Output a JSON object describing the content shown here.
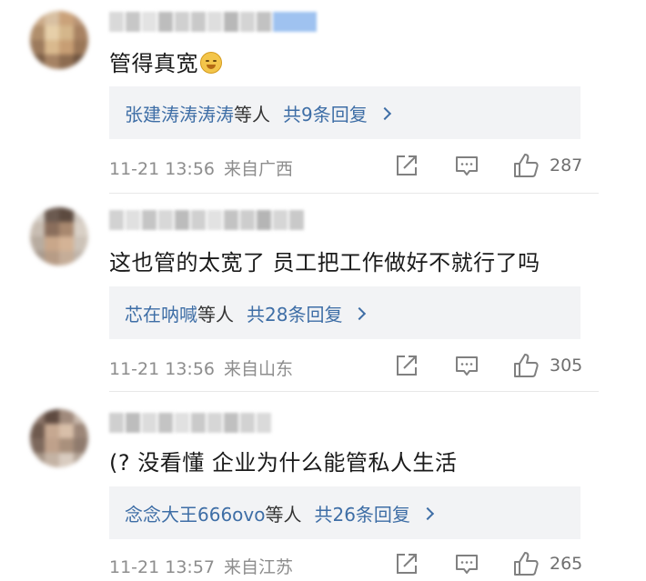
{
  "comments": [
    {
      "text": "管得真宽",
      "emoji": "grimacing-emoji",
      "reply_names": "张建涛涛涛涛",
      "reply_suffix": "等人",
      "reply_count": "共9条回复",
      "time": "11-21 13:56",
      "location": "来自广西",
      "likes": "287"
    },
    {
      "text": "这也管的太宽了 员工把工作做好不就行了吗",
      "reply_names": "芯在呐喊",
      "reply_suffix": "等人",
      "reply_count": "共28条回复",
      "time": "11-21 13:56",
      "location": "来自山东",
      "likes": "305"
    },
    {
      "text": "(? 没看懂 企业为什么能管私人生活",
      "reply_names": "念念大王666ovo",
      "reply_suffix": "等人",
      "reply_count": "共26条回复",
      "time": "11-21 13:57",
      "location": "来自江苏",
      "likes": "265"
    }
  ],
  "icons": {
    "share": "share-icon",
    "comment": "comment-icon",
    "like": "thumbs-up-icon",
    "reply_arrow": "chevron-right-icon"
  },
  "colors": {
    "link": "#3e6ea6",
    "reply_background": "#f2f3f5",
    "meta_text": "#8d8d8d"
  }
}
